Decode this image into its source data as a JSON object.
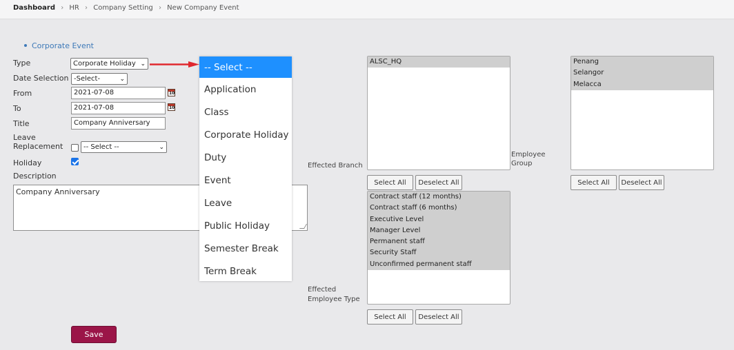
{
  "breadcrumb": [
    "Dashboard",
    "HR",
    "Company Setting",
    "New Company Event"
  ],
  "section_link": "Corporate Event",
  "form": {
    "type_label": "Type",
    "type_value": "Corporate Holiday",
    "date_selection_label": "Date Selection",
    "date_selection_value": "-Select-",
    "from_label": "From",
    "from_value": "2021-07-08",
    "to_label": "To",
    "to_value": "2021-07-08",
    "title_label": "Title",
    "title_value": "Company Anniversary",
    "leave_replacement_label_1": "Leave",
    "leave_replacement_label_2": "Replacement",
    "leave_replacement_select": "-- Select --",
    "holiday_label": "Holiday",
    "holiday_checked": true,
    "description_label": "Description",
    "description_value": "Company Anniversary",
    "save_label": "Save"
  },
  "type_dropdown": {
    "options": [
      "-- Select --",
      "Application",
      "Class",
      "Corporate Holiday",
      "Duty",
      "Event",
      "Leave",
      "Public Holiday",
      "Semester Break",
      "Term Break"
    ],
    "highlighted": "-- Select --"
  },
  "effected_branch": {
    "label": "Effected Branch",
    "items": [
      "ALSC_HQ"
    ],
    "select_all": "Select All",
    "deselect_all": "Deselect All"
  },
  "employee_group": {
    "label_1": "Employee",
    "label_2": "Group",
    "items": [
      "Penang",
      "Selangor",
      "Melacca"
    ],
    "select_all": "Select All",
    "deselect_all": "Deselect All"
  },
  "effected_employee_type": {
    "label_1": "Effected",
    "label_2": "Employee Type",
    "items": [
      "Contract staff (12 months)",
      "Contract staff (6 months)",
      "Executive Level",
      "Manager Level",
      "Permanent staff",
      "Security Staff",
      "Unconfirmed permanent staff"
    ],
    "select_all": "Select All",
    "deselect_all": "Deselect All"
  },
  "colors": {
    "accent_link": "#3d79b8",
    "save_button": "#9b1548",
    "dropdown_highlight": "#1e90ff",
    "arrow": "#e0282e"
  }
}
